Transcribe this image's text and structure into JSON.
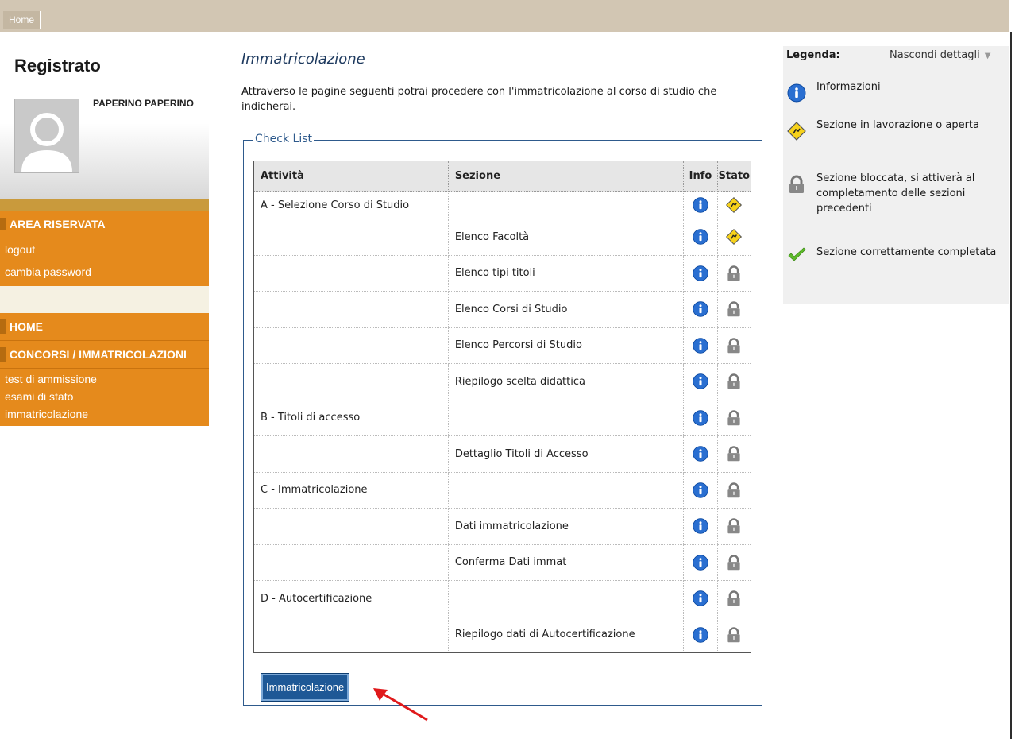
{
  "topbar": {
    "home_label": "Home"
  },
  "sidebar": {
    "title": "Registrato",
    "user_name": "PAPERINO PAPERINO",
    "area_riservata": {
      "header": "AREA RISERVATA",
      "links": [
        "logout",
        "cambia password"
      ]
    },
    "nav": {
      "home": "HOME",
      "concorsi": "CONCORSI / IMMATRICOLAZIONI",
      "sub_links": [
        "test di ammissione",
        "esami di stato",
        "immatricolazione"
      ]
    }
  },
  "main": {
    "title": "Immatricolazione",
    "intro": "Attraverso le pagine seguenti potrai procedere con l'immatricolazione al corso di studio che indicherai.",
    "checklist": {
      "legend": "Check List",
      "headers": {
        "attivita": "Attività",
        "sezione": "Sezione",
        "info": "Info",
        "stato": "Stato"
      },
      "rows": [
        {
          "attivita": "A - Selezione Corso di Studio",
          "sezione": "",
          "stato": "in-progress"
        },
        {
          "attivita": "",
          "sezione": "Elenco Facoltà",
          "stato": "in-progress"
        },
        {
          "attivita": "",
          "sezione": "Elenco tipi titoli",
          "stato": "locked"
        },
        {
          "attivita": "",
          "sezione": "Elenco Corsi di Studio",
          "stato": "locked"
        },
        {
          "attivita": "",
          "sezione": "Elenco Percorsi di Studio",
          "stato": "locked"
        },
        {
          "attivita": "",
          "sezione": "Riepilogo scelta didattica",
          "stato": "locked"
        },
        {
          "attivita": "B - Titoli di accesso",
          "sezione": "",
          "stato": "locked"
        },
        {
          "attivita": "",
          "sezione": "Dettaglio Titoli di Accesso",
          "stato": "locked"
        },
        {
          "attivita": "C - Immatricolazione",
          "sezione": "",
          "stato": "locked"
        },
        {
          "attivita": "",
          "sezione": "Dati immatricolazione",
          "stato": "locked"
        },
        {
          "attivita": "",
          "sezione": "Conferma Dati immat",
          "stato": "locked"
        },
        {
          "attivita": "D - Autocertificazione",
          "sezione": "",
          "stato": "locked"
        },
        {
          "attivita": "",
          "sezione": "Riepilogo dati di Autocertificazione",
          "stato": "locked"
        }
      ]
    },
    "button_label": "Immatricolazione"
  },
  "legend": {
    "title": "Legenda:",
    "toggle": "Nascondi dettagli",
    "items": [
      {
        "icon": "info-icon",
        "text": "Informazioni"
      },
      {
        "icon": "in-progress-icon",
        "text": "Sezione in lavorazione o aperta"
      },
      {
        "icon": "lock-icon",
        "text": "Sezione bloccata, si attiverà al completamento delle sezioni precedenti"
      },
      {
        "icon": "check-icon",
        "text": "Sezione correttamente completata"
      }
    ]
  },
  "colors": {
    "orange": "#e58a1c",
    "topbar": "#d2c6b3",
    "button": "#1e5896",
    "title": "#1e3a5f"
  }
}
